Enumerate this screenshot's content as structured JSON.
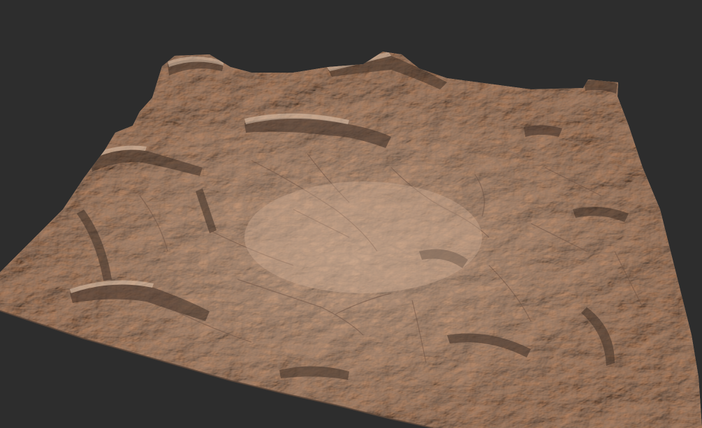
{
  "scene": {
    "subject": "terrain-heightmap-render",
    "background_color": "#2d2d2d",
    "terrain_base_color": "#c9a48a",
    "terrain_light_color": "#e3c4aa",
    "terrain_shadow_color": "#4a3a30",
    "terrain_mid_color": "#a88670"
  }
}
